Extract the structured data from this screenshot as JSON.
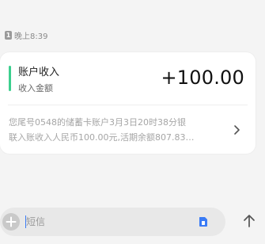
{
  "conversation": {
    "sim_badge": "1",
    "timestamp": "晚上8:39"
  },
  "message_card": {
    "title": "账户收入",
    "subtitle": "收入金额",
    "amount": "+100.00",
    "details_line1": "您尾号0548的储蓄卡账户3月3日20时38分银",
    "details_line2": "联入账收入人民币100.00元,活期余额807.83…",
    "accent_color": "#3ccf8e"
  },
  "composer": {
    "input_value": "",
    "input_placeholder": "短信",
    "sim_icon_color": "#3a7bf5",
    "icons": [
      "plus-icon",
      "sim-card-icon",
      "send-arrow-icon"
    ]
  }
}
